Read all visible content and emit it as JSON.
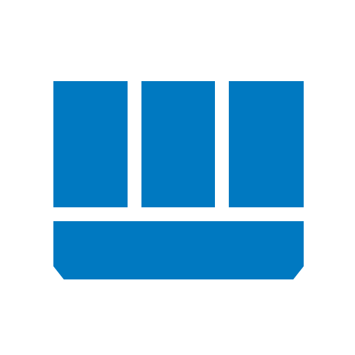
{
  "icon": {
    "name": "columns-with-base-panel-icon",
    "color": "#0079C1",
    "background": "#FFFFFF",
    "upper_panel_count": 3,
    "lower_panel_count": 1
  }
}
